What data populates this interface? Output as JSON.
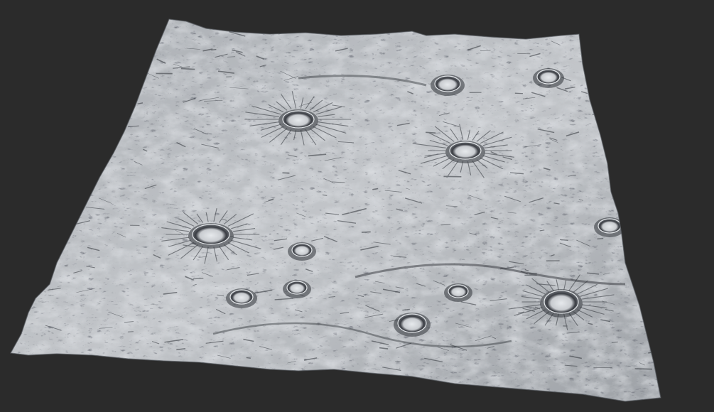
{
  "scene": {
    "subject": "terrain-heightfield-mesh",
    "background_color": "#2b2b2b",
    "terrain_base_color": "#b9bcc0",
    "terrain_highlight_color": "#dfe2e6",
    "terrain_shadow_color": "#3a3d42",
    "crater_count": 12
  }
}
